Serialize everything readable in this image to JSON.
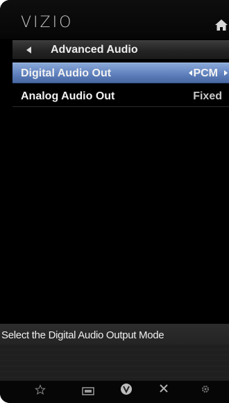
{
  "brand": {
    "logo_text": "VIZIO"
  },
  "breadcrumb": {
    "title": "Advanced Audio"
  },
  "menu": {
    "items": [
      {
        "label": "Digital Audio Out",
        "value": "PCM",
        "selected": true
      },
      {
        "label": "Analog Audio Out",
        "value": "Fixed",
        "selected": false
      }
    ]
  },
  "help": {
    "text": "Select the Digital Audio Output Mode"
  },
  "bottom_bar": {
    "icons": [
      "star-icon",
      "input-icon",
      "vizio-v-icon",
      "close-icon",
      "gear-icon"
    ]
  },
  "colors": {
    "selected_row": "#5f80bd",
    "background": "#000000",
    "text": "#f2f2f2"
  }
}
